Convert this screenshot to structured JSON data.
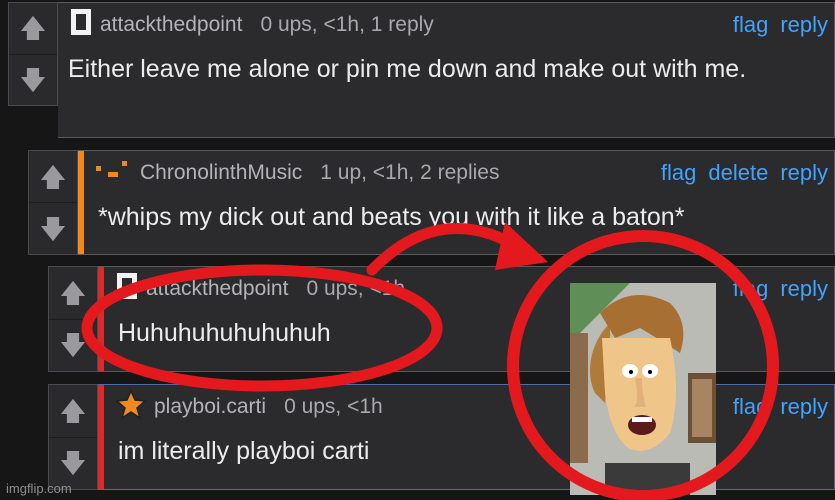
{
  "comments": [
    {
      "username": "attackthedpoint",
      "stats": "0 ups, <1h, 1 reply",
      "actions": [
        "flag",
        "reply"
      ],
      "text": "Either leave me alone or pin me down and make out with me.",
      "accent": "#2b2b2d",
      "avatar": "white-block-icon"
    },
    {
      "username": "ChronolinthMusic",
      "stats": "1 up, <1h, 2 replies",
      "actions": [
        "flag",
        "delete",
        "reply"
      ],
      "text": "*whips my dick out and beats you with it like a baton*",
      "accent": "#f08a1c",
      "avatar": "orange-pixel-icon"
    },
    {
      "username": "attackthedpoint",
      "stats": "0 ups, <1h",
      "actions": [
        "flag",
        "reply"
      ],
      "text": "Huhuhuhuhuhuhuh",
      "accent": "#d92b2b",
      "avatar": "white-block-icon"
    },
    {
      "username": "playboi.carti",
      "stats": "0 ups, <1h",
      "actions": [
        "flag",
        "reply"
      ],
      "text": "im literally playboi carti",
      "accent": "#d92b2b",
      "avatar": "star-icon"
    }
  ],
  "vote": {
    "up_icon": "arrow-up-icon",
    "down_icon": "arrow-down-icon"
  },
  "colors": {
    "link": "#3fa3ff",
    "annotation_red": "#e3191e",
    "background": "#161616"
  },
  "watermark": "imgflip.com"
}
